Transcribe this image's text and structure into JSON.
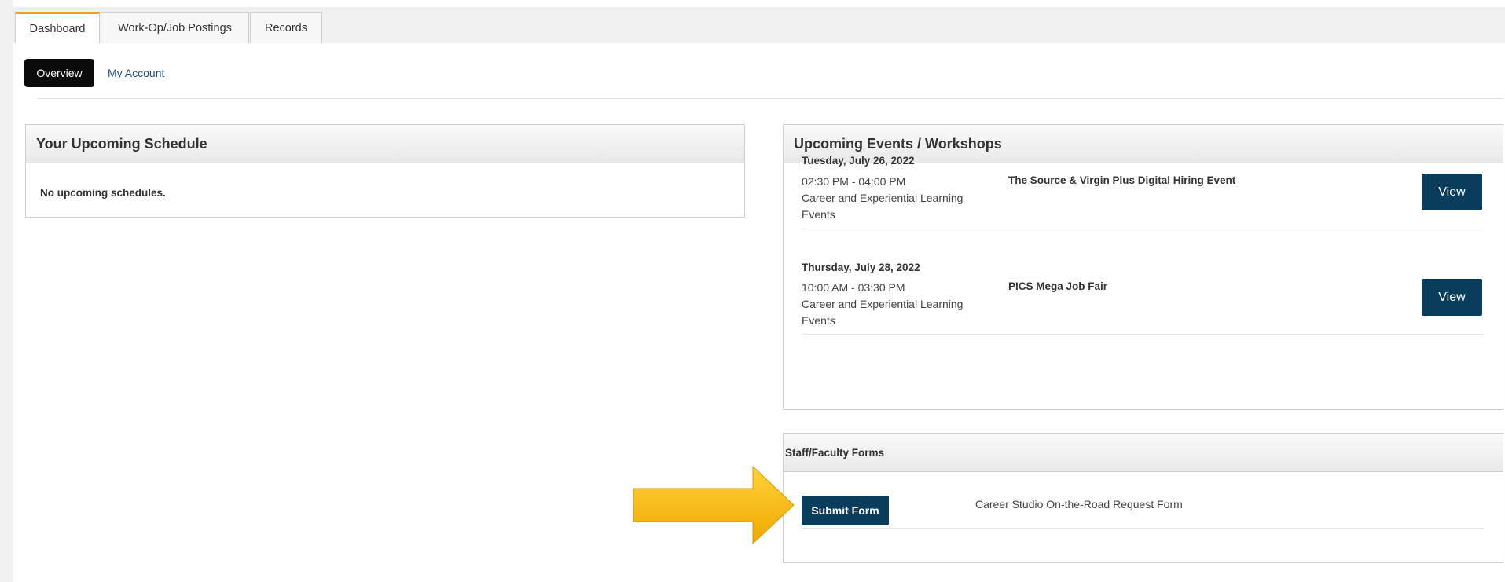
{
  "tabs": [
    {
      "label": "Dashboard",
      "active": true
    },
    {
      "label": "Work-Op/Job Postings",
      "active": false
    },
    {
      "label": "Records",
      "active": false
    }
  ],
  "subnav": {
    "overview_label": "Overview",
    "account_label": "My Account"
  },
  "schedule": {
    "title": "Your Upcoming Schedule",
    "empty_text": "No upcoming schedules."
  },
  "events": {
    "title": "Upcoming Events / Workshops",
    "items": [
      {
        "date": "Tuesday, July 26, 2022",
        "time": "02:30 PM - 04:00 PM",
        "category_line1": "Career and Experiential Learning",
        "category_line2": "Events",
        "title": "The Source & Virgin Plus Digital Hiring Event",
        "button": "View"
      },
      {
        "date": "Thursday, July 28, 2022",
        "time": "10:00 AM - 03:30 PM",
        "category_line1": "Career and Experiential Learning",
        "category_line2": "Events",
        "title": "PICS Mega Job Fair",
        "button": "View"
      }
    ]
  },
  "forms": {
    "title": "Staff/Faculty Forms",
    "button": "Submit Form",
    "form_name": "Career Studio On-the-Road Request Form"
  },
  "colors": {
    "primary_button": "#0a3d5c",
    "active_tab_accent": "#f0a020",
    "arrow": "#f5b400",
    "link": "#1f4e8a"
  },
  "icons": {
    "pointer_arrow": "arrow-right-icon"
  }
}
